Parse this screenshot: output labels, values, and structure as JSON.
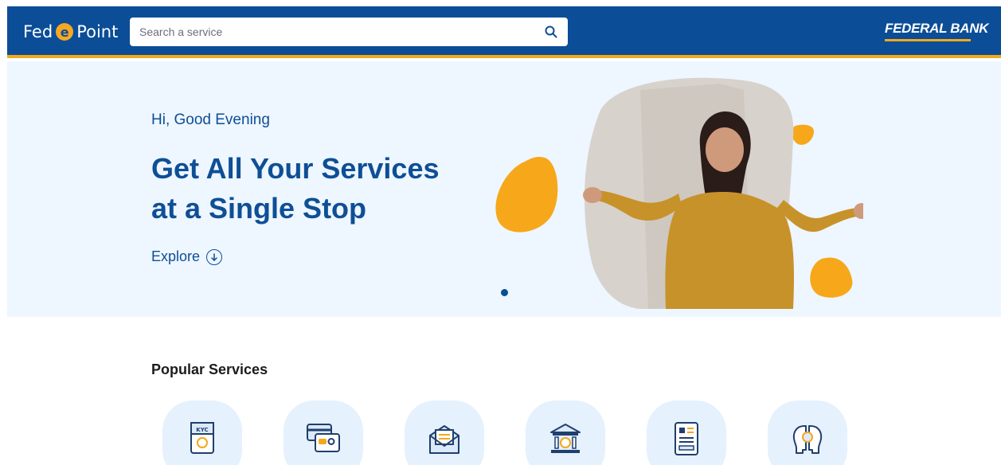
{
  "header": {
    "logo_left": "Fed",
    "logo_e": "e",
    "logo_right": "Point",
    "search_placeholder": "Search a service",
    "bank_name": "FEDERAL BANK"
  },
  "hero": {
    "greeting": "Hi, Good Evening",
    "headline_line1": "Get All Your Services",
    "headline_line2": "at a Single Stop",
    "explore_label": "Explore"
  },
  "popular": {
    "title": "Popular Services",
    "items": [
      {
        "icon": "kyc-update-icon",
        "label": "KYC"
      },
      {
        "icon": "card-services-icon"
      },
      {
        "icon": "mail-request-icon"
      },
      {
        "icon": "bank-transfer-icon"
      },
      {
        "icon": "document-icon"
      },
      {
        "icon": "customer-insight-icon"
      }
    ]
  },
  "colors": {
    "primary": "#0b4d97",
    "accent": "#f3a81c",
    "hero_bg": "#eef6ff",
    "service_bg": "#e5f1fd"
  }
}
